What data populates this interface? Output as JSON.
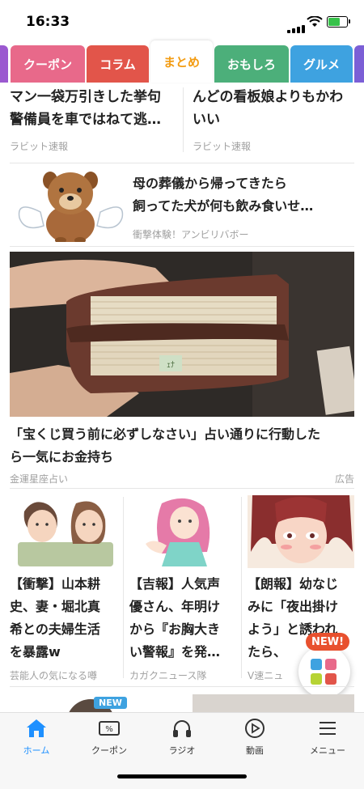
{
  "status": {
    "time": "16:33"
  },
  "tabs": [
    {
      "label": "クーポン",
      "color": "#e8698a"
    },
    {
      "label": "コラム",
      "color": "#e2554a"
    },
    {
      "label": "まとめ",
      "color": "#f39c12",
      "active": true
    },
    {
      "label": "おもしろ",
      "color": "#4caf7a"
    },
    {
      "label": "グルメ",
      "color": "#3ea2e0"
    }
  ],
  "articles": {
    "top_left": {
      "title_line1": "マン一袋万引きした挙句",
      "title_line2": "警備員を車ではねて逃…",
      "source": "ラビット速報"
    },
    "top_right": {
      "title_line1": "んどの看板娘よりもかわ",
      "title_line2": "いい",
      "source": "ラビット速報"
    },
    "dog": {
      "title_line1": "母の葬儀から帰ってきたら",
      "title_line2": "飼ってた犬が何も飲み食いせ…",
      "source": "衝撃体験！アンビリバボー"
    },
    "ad": {
      "title_line1": "「宝くじ買う前に必ずしなさい」占い通りに行動した",
      "title_line2": "ら一気にお金持ち",
      "source": "金運星座占い",
      "ad_label": "広告",
      "wallet_text": "ｪﾅ"
    },
    "grid": [
      {
        "title": [
          "【衝撃】山本耕",
          "史、妻・堀北真",
          "希との夫婦生活",
          "を暴露w"
        ],
        "source": "芸能人の気になる噂"
      },
      {
        "title": [
          "【吉報】人気声",
          "優さん、年明け",
          "から『お胸大き",
          "い警報』を発…"
        ],
        "source": "カガクニュース隊"
      },
      {
        "title": [
          "【朗報】幼なじ",
          "みに「夜出掛け",
          "よう」と誘われ",
          "たら、"
        ],
        "source": "V速ニュ"
      }
    ]
  },
  "floating": {
    "new_badge": "NEW!"
  },
  "next_new_badge": "NEW",
  "bottom_nav": [
    {
      "label": "ホーム",
      "icon": "home-icon",
      "active": true
    },
    {
      "label": "クーポン",
      "icon": "coupon-icon"
    },
    {
      "label": "ラジオ",
      "icon": "headphones-icon"
    },
    {
      "label": "動画",
      "icon": "play-icon"
    },
    {
      "label": "メニュー",
      "icon": "menu-icon"
    }
  ]
}
